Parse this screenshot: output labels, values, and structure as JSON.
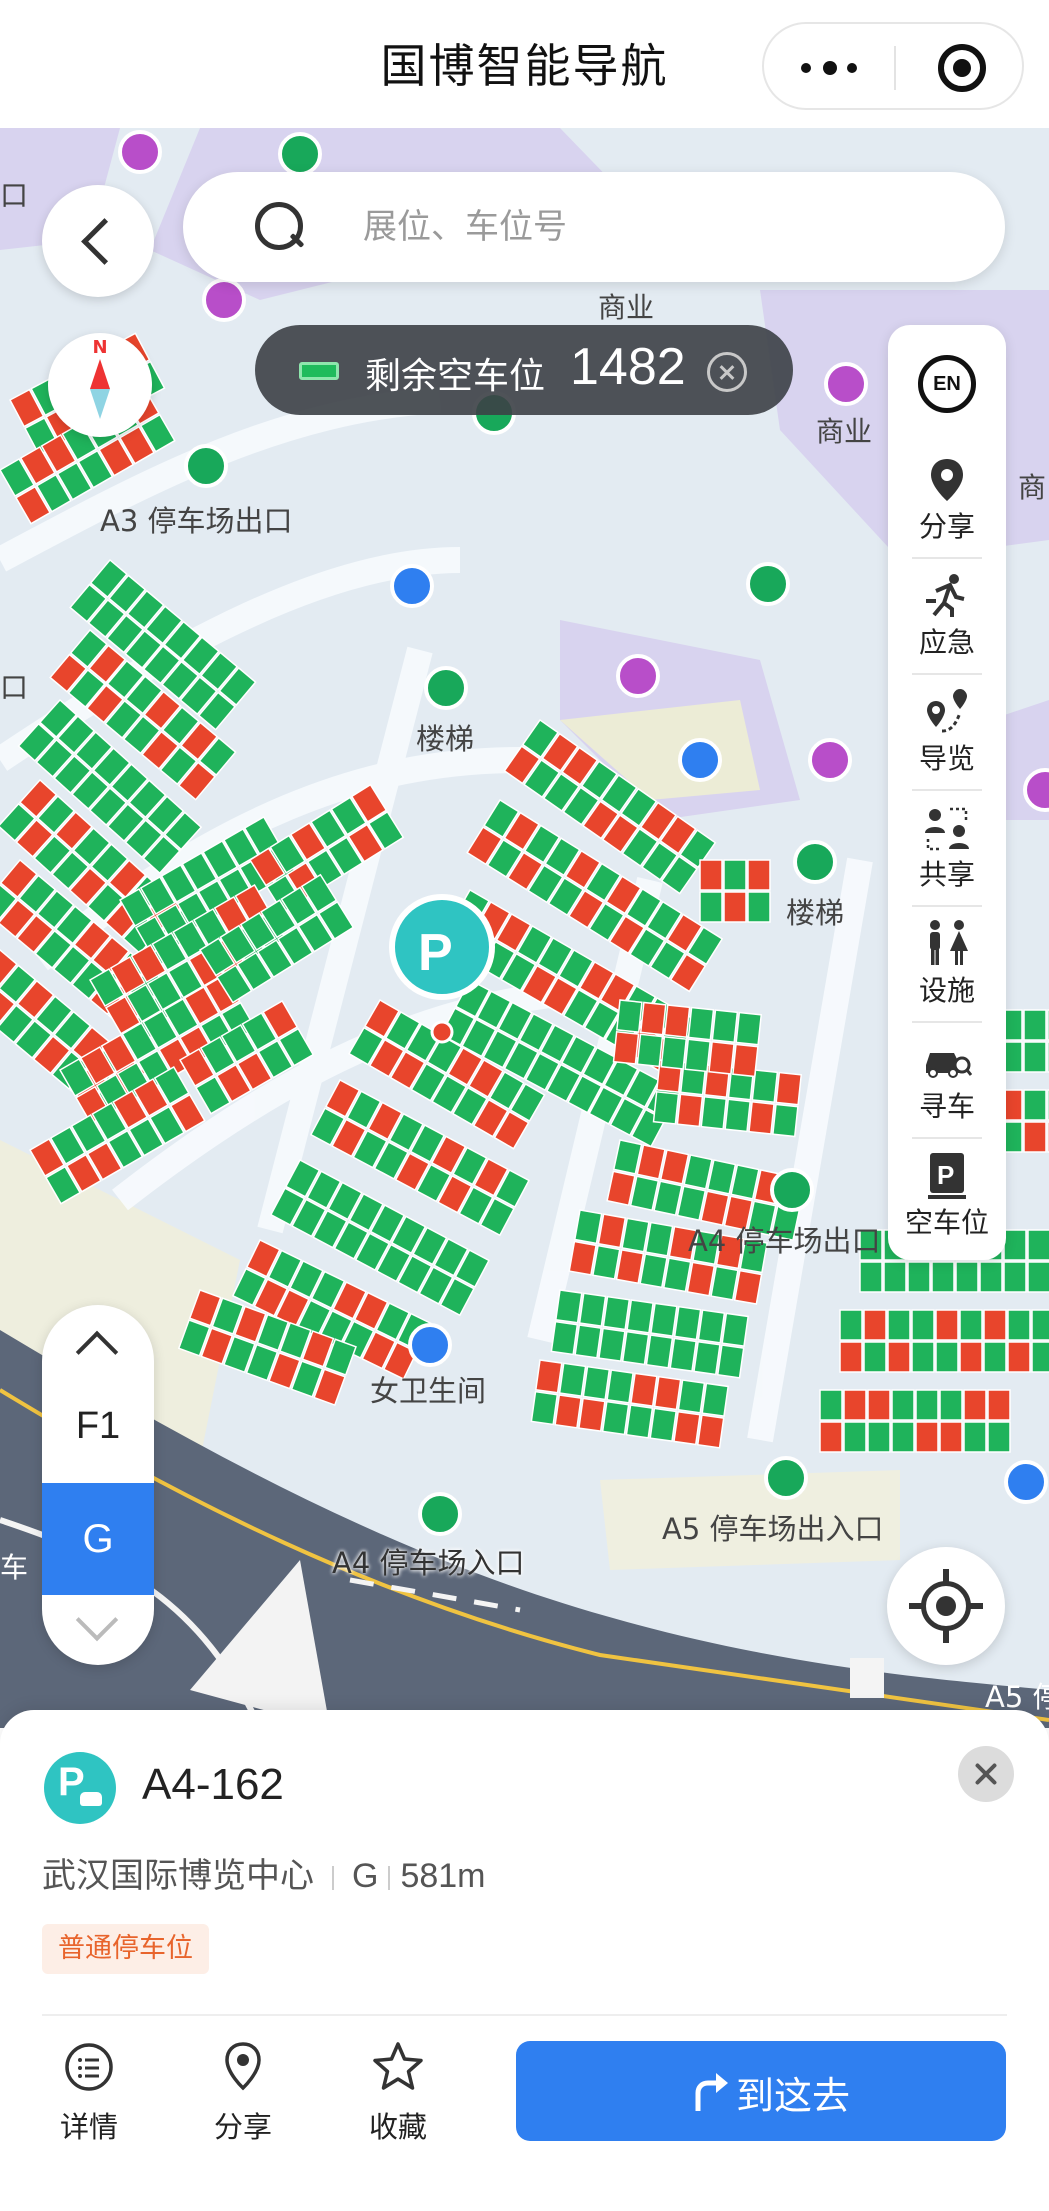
{
  "header": {
    "title": "国博智能导航"
  },
  "search": {
    "placeholder": "展位、车位号"
  },
  "compass": {
    "north_label": "N"
  },
  "remaining": {
    "label": "剩余空车位",
    "count": "1482"
  },
  "toolbar": {
    "language": "EN",
    "items": [
      {
        "label": "分享",
        "icon": "location-pin-icon"
      },
      {
        "label": "应急",
        "icon": "emergency-exit-icon"
      },
      {
        "label": "导览",
        "icon": "tour-route-icon"
      },
      {
        "label": "共享",
        "icon": "shared-location-icon"
      },
      {
        "label": "设施",
        "icon": "restroom-icon"
      },
      {
        "label": "寻车",
        "icon": "find-car-icon"
      },
      {
        "label": "空车位",
        "icon": "empty-parking-icon"
      }
    ]
  },
  "floors": {
    "items": [
      "F1",
      "G"
    ],
    "selected": "G"
  },
  "map": {
    "labels": {
      "commerce_1": "商业",
      "commerce_2": "商业",
      "commerce_3": "商",
      "exit_a3": "A3 停车场出口",
      "stairs_1": "楼梯",
      "stairs_2": "楼梯",
      "exit_a4": "A4 停车场出口",
      "womens_restroom": "女卫生间",
      "entrance_a4": "A4 停车场入口",
      "entrance_exit_a5": "A5 停车场出入口",
      "road_a5": "A5 停",
      "edge_left_1": "口",
      "edge_left_2": "口",
      "edge_left_3": "车"
    },
    "colors": {
      "occupied": "#e8452c",
      "free": "#1fb35b",
      "water": "#d6e8f5",
      "commerce": "#d9d4f2",
      "road": "#5f6b7c"
    }
  },
  "detail": {
    "spot_id": "A4-162",
    "venue": "武汉国际博览中心",
    "floor": "G",
    "distance": "581m",
    "tag": "普通停车位",
    "actions": {
      "details": "详情",
      "share": "分享",
      "favorite": "收藏"
    },
    "go_label": "到这去"
  }
}
